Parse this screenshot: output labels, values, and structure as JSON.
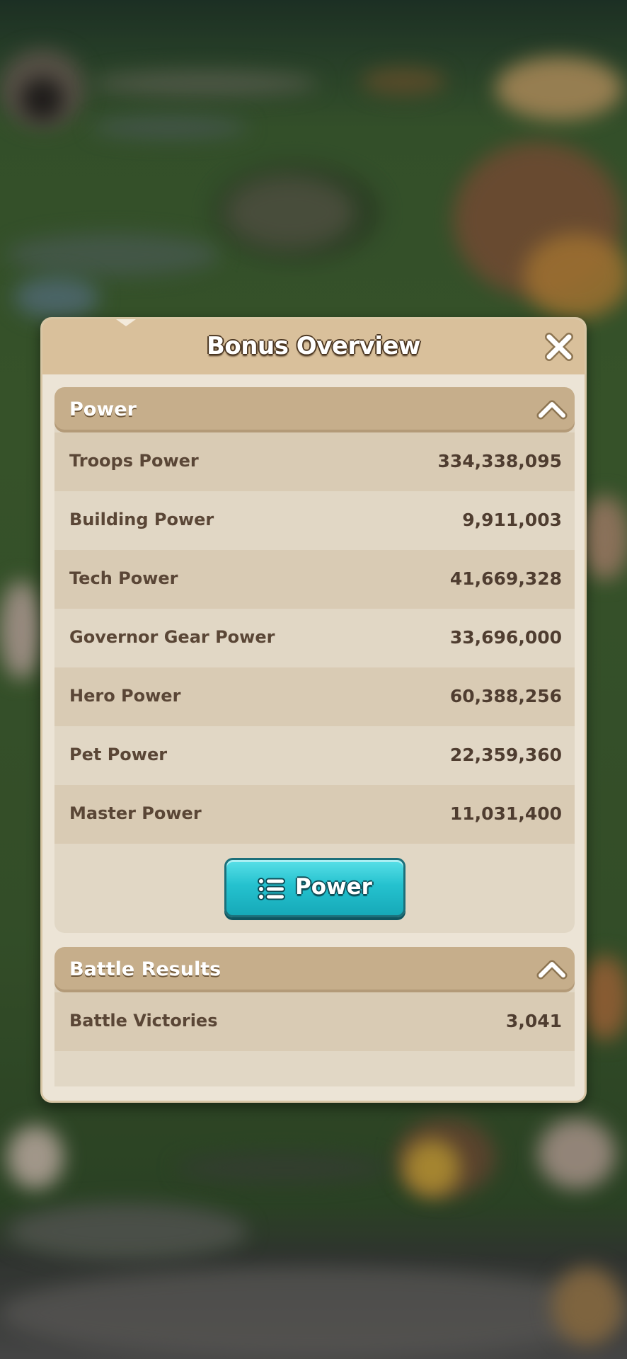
{
  "dialog": {
    "title": "Bonus Overview",
    "close_icon": "close-x-icon"
  },
  "sections": [
    {
      "title": "Power",
      "chevron_icon": "chevron-up-icon",
      "rows": [
        {
          "label": "Troops Power",
          "value": "334,338,095"
        },
        {
          "label": "Building Power",
          "value": "9,911,003"
        },
        {
          "label": "Tech Power",
          "value": "41,669,328"
        },
        {
          "label": "Governor Gear Power",
          "value": "33,696,000"
        },
        {
          "label": "Hero Power",
          "value": "60,388,256"
        },
        {
          "label": "Pet Power",
          "value": "22,359,360"
        },
        {
          "label": "Master Power",
          "value": "11,031,400"
        }
      ],
      "button": {
        "label": "Power",
        "icon": "list-icon"
      }
    },
    {
      "title": "Battle Results",
      "chevron_icon": "chevron-up-icon",
      "rows": [
        {
          "label": "Battle Victories",
          "value": "3,041"
        }
      ]
    }
  ],
  "colors": {
    "header_bg": "#d9c09b",
    "panel_bg": "#ece4d6",
    "section_header": "#c6ae8b",
    "row_dark": "#d9cbb4",
    "row_light": "#e1d7c5",
    "text_brown": "#5a4636",
    "button_teal": "#25c2cf"
  }
}
